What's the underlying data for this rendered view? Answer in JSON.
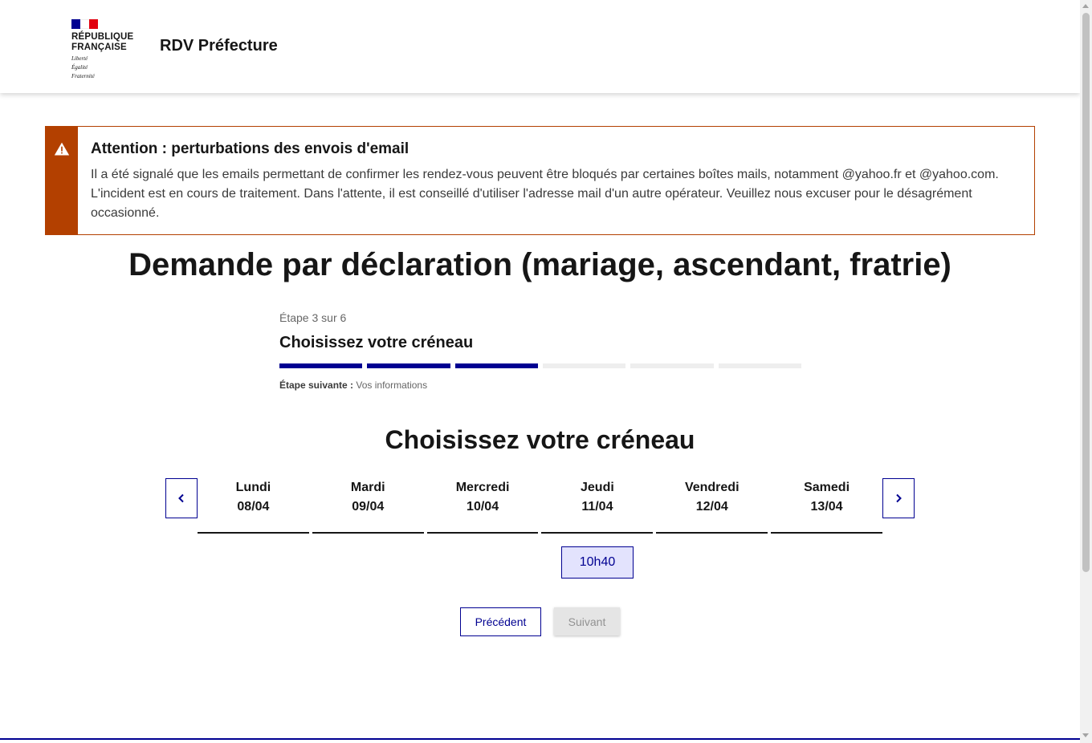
{
  "header": {
    "logo_line1": "RÉPUBLIQUE",
    "logo_line2": "FRANÇAISE",
    "motto1": "Liberté",
    "motto2": "Égalité",
    "motto3": "Fraternité",
    "site_title": "RDV Préfecture"
  },
  "alert": {
    "title": "Attention : perturbations des envois d'email",
    "text": "Il a été signalé que les emails permettant de confirmer les rendez-vous peuvent être bloqués par certaines boîtes mails, notamment @yahoo.fr et @yahoo.com. L'incident est en cours de traitement. Dans l'attente, il est conseillé d'utiliser l'adresse mail d'un autre opérateur. Veuillez nous excuser pour le désagrément occasionné.",
    "icon": "warning-icon",
    "color": "#b34000"
  },
  "main_title": "Demande par déclaration (mariage, ascendant, fratrie)",
  "stepper": {
    "state": "Étape 3 sur 6",
    "title": "Choisissez votre créneau",
    "current_step": 3,
    "total_steps": 6,
    "next_label": "Étape suivante :",
    "next_value": "Vos informations",
    "accent": "#000091"
  },
  "slots": {
    "title": "Choisissez votre créneau",
    "prev_icon": "chevron-left-icon",
    "next_icon": "chevron-right-icon",
    "days": [
      {
        "name": "Lundi",
        "date": "08/04"
      },
      {
        "name": "Mardi",
        "date": "09/04"
      },
      {
        "name": "Mercredi",
        "date": "10/04"
      },
      {
        "name": "Jeudi",
        "date": "11/04"
      },
      {
        "name": "Vendredi",
        "date": "12/04"
      },
      {
        "name": "Samedi",
        "date": "13/04"
      }
    ],
    "available_slot": "10h40"
  },
  "actions": {
    "previous": "Précédent",
    "next": "Suivant"
  }
}
